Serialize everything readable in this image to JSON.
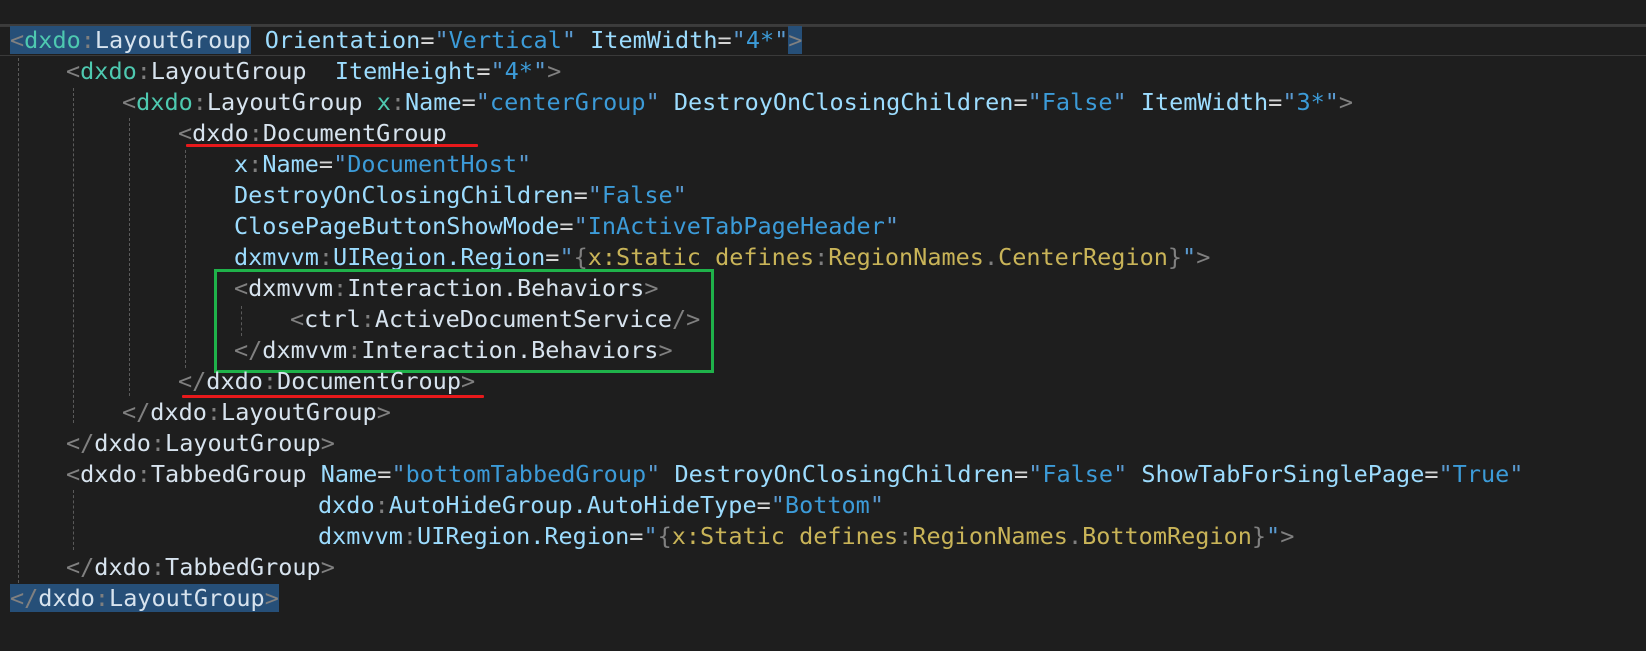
{
  "editor": {
    "language": "XAML",
    "colors": {
      "background": "#1e1e1e",
      "selection": "#264f78",
      "annotation_red": "#e8191b",
      "annotation_green": "#1fb24a"
    },
    "lines": {
      "l1": {
        "p": "dxdo",
        "n": "LayoutGroup",
        "a1": "Orientation",
        "v1": "Vertical",
        "a2": "ItemWidth",
        "v2": "4*"
      },
      "l2": {
        "p": "dxdo",
        "n": "LayoutGroup",
        "a1": "ItemHeight",
        "v1": "4*"
      },
      "l3": {
        "p": "dxdo",
        "n": "LayoutGroup",
        "a1p": "x",
        "a1": "Name",
        "v1": "centerGroup",
        "a2": "DestroyOnClosingChildren",
        "v2": "False",
        "a3": "ItemWidth",
        "v3": "3*"
      },
      "l4": {
        "p": "dxdo",
        "n": "DocumentGroup"
      },
      "l5": {
        "ap": "x",
        "a": "Name",
        "v": "DocumentHost"
      },
      "l6": {
        "a": "DestroyOnClosingChildren",
        "v": "False"
      },
      "l7": {
        "a": "ClosePageButtonShowMode",
        "v": "InActiveTabPageHeader"
      },
      "l8": {
        "ap": "dxmvvm",
        "a": "UIRegion.Region",
        "ext": "x:Static",
        "ns": "defines",
        "cls": "RegionNames",
        "mem": "CenterRegion"
      },
      "l9": {
        "p": "dxmvvm",
        "n": "Interaction.Behaviors"
      },
      "l10": {
        "p": "ctrl",
        "n": "ActiveDocumentService"
      },
      "l11": {
        "p": "dxmvvm",
        "n": "Interaction.Behaviors"
      },
      "l12": {
        "p": "dxdo",
        "n": "DocumentGroup"
      },
      "l13": {
        "p": "dxdo",
        "n": "LayoutGroup"
      },
      "l14": {
        "p": "dxdo",
        "n": "LayoutGroup"
      },
      "l15": {
        "p": "dxdo",
        "n": "TabbedGroup",
        "a1": "Name",
        "v1": "bottomTabbedGroup",
        "a2": "DestroyOnClosingChildren",
        "v2": "False",
        "a3": "ShowTabForSinglePage",
        "v3": "True"
      },
      "l16": {
        "ap": "dxdo",
        "a": "AutoHideGroup.AutoHideType",
        "v": "Bottom"
      },
      "l17": {
        "ap": "dxmvvm",
        "a": "UIRegion.Region",
        "ext": "x:Static",
        "ns": "defines",
        "cls": "RegionNames",
        "mem": "BottomRegion"
      },
      "l18": {
        "p": "dxdo",
        "n": "TabbedGroup"
      },
      "l19": {
        "p": "dxdo",
        "n": "LayoutGroup"
      }
    }
  }
}
